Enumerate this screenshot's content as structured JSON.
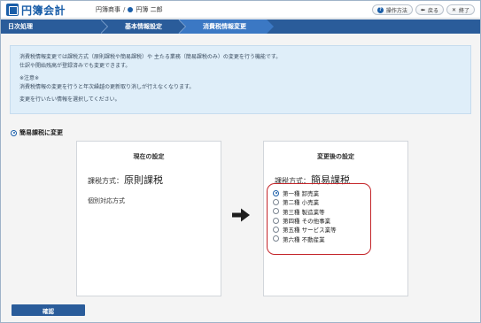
{
  "app": {
    "logo_text": "円簿会計",
    "breadcrumb": {
      "office": "円簿商事",
      "separator": "/",
      "user": "円簿 二郎"
    }
  },
  "top_buttons": [
    {
      "label": "操作方法",
      "icon": "help-icon"
    },
    {
      "label": "戻る",
      "icon": "back-arrow-icon"
    },
    {
      "label": "終了",
      "icon": "close-icon"
    }
  ],
  "steps": [
    {
      "label": "日次処理"
    },
    {
      "label": "基本情報設定"
    },
    {
      "label": "消費税情報変更"
    }
  ],
  "info": {
    "line1": "消費税情報変更では課税方式（原則課税や簡易課税）や 主たる業務（簡易課税のみ）の変更を行う機能です。",
    "line2": "仕訳や開始残高が登録済みでも変更できます。",
    "line3": "※注意※",
    "line4": "消費税情報の変更を行うと年次繰越の更新取り消しが行えなくなります。",
    "line5": "変更を行いたい情報を選択してください。"
  },
  "section_label": "簡易課税に変更",
  "current": {
    "title": "現在の設定",
    "tax_label": "課税方式：",
    "tax_value": "原則課税",
    "method": "個別対応方式"
  },
  "after": {
    "title": "変更後の設定",
    "tax_label": "課税方式：",
    "tax_value": "簡易課税",
    "selected_index": 0,
    "options": [
      "第一種 卸売業",
      "第二種 小売業",
      "第三種 製造業等",
      "第四種 その他事業",
      "第五種 サービス業等",
      "第六種 不動産業"
    ]
  },
  "confirm_label": "確認",
  "colors": {
    "primary": "#2a5c9a",
    "active_step": "#3b78c4",
    "highlight_border": "#c4252a",
    "info_bg": "#dfeef9"
  }
}
